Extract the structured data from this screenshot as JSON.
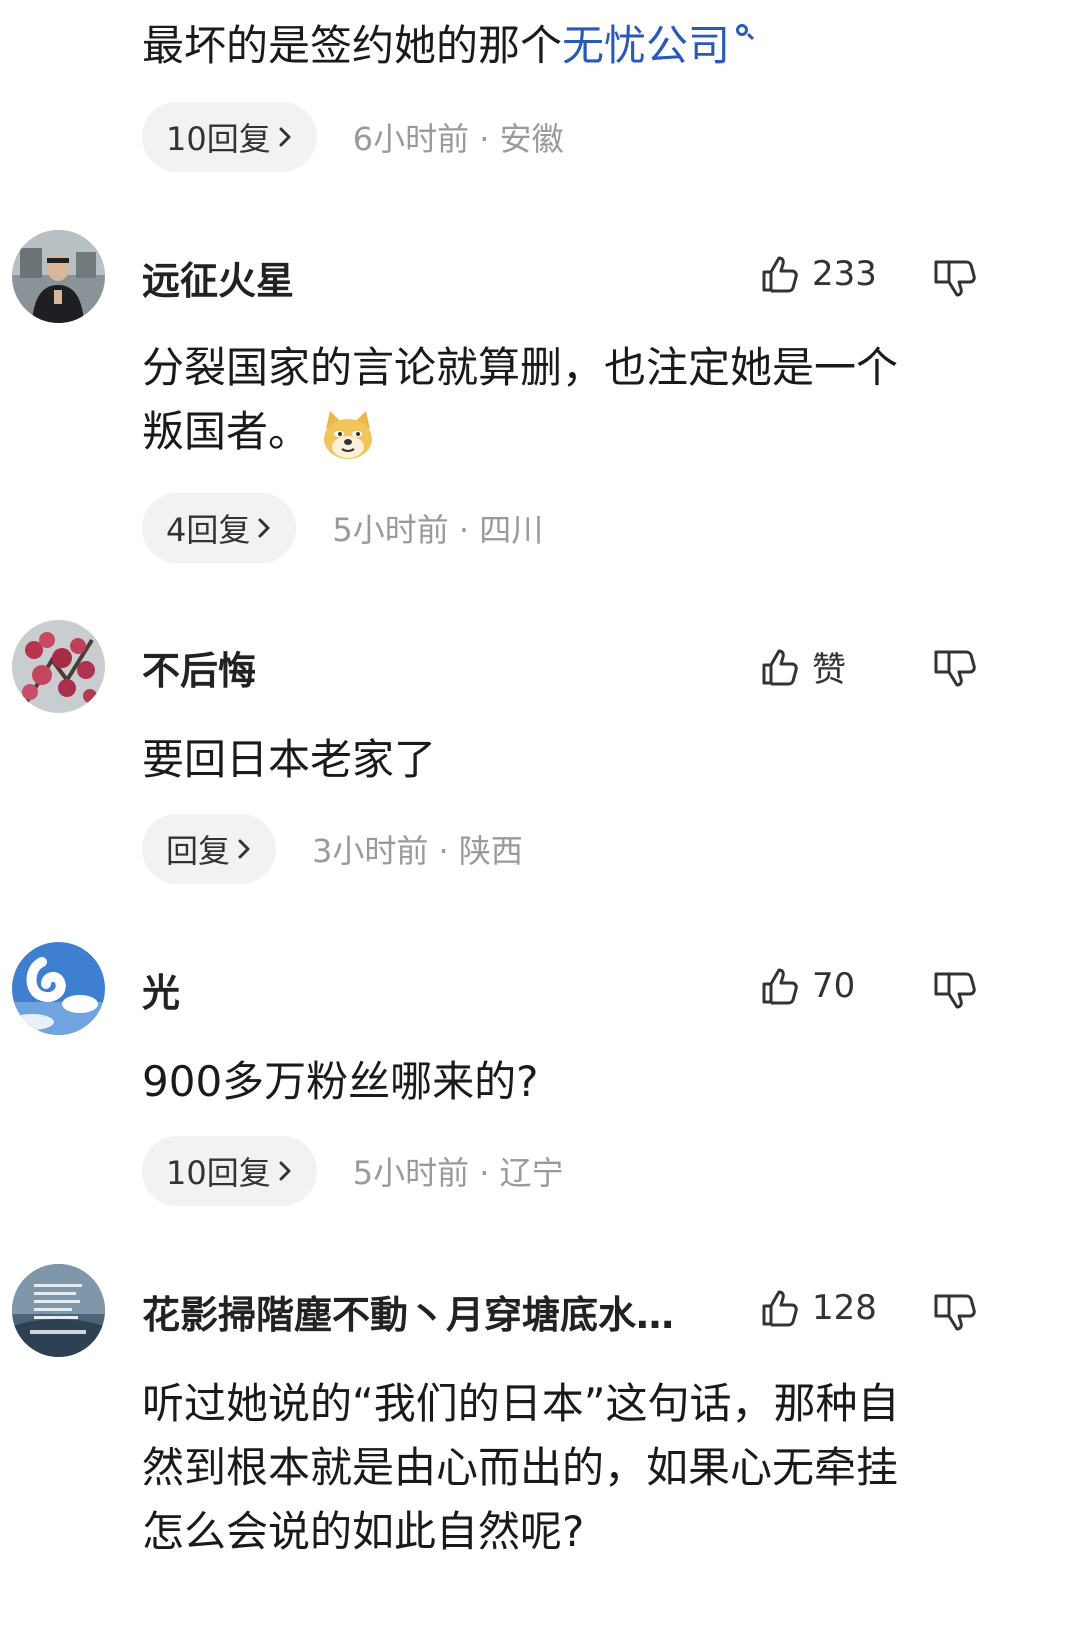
{
  "top_comment": {
    "text": "最坏的是签约她的那个",
    "link": "无忧公司",
    "reply_label": "10回复",
    "time_location": "6小时前 · 安徽"
  },
  "comments": [
    {
      "username": "远征火星",
      "likes": "233",
      "text_lines": [
        "分裂国家的言论就算删，也注定她是一个",
        "叛国者。"
      ],
      "reply_label": "4回复",
      "time_location": "5小时前 · 四川"
    },
    {
      "username": "不后悔",
      "likes": "赞",
      "text_lines": [
        "要回日本老家了"
      ],
      "reply_label": "回复",
      "time_location": "3小时前 · 陕西"
    },
    {
      "username": "光",
      "likes": "70",
      "text_lines": [
        "900多万粉丝哪来的?"
      ],
      "reply_label": "10回复",
      "time_location": "5小时前 · 辽宁"
    },
    {
      "username": "花影掃階塵不動丶月穿塘底水…",
      "likes": "128",
      "text_lines": [
        "听过她说的“我们的日本”这句话，那种自",
        "然到根本就是由心而出的，如果心无牵挂",
        "怎么会说的如此自然呢?"
      ]
    }
  ],
  "icons": {
    "like": "thumbs-up-icon",
    "dislike": "thumbs-down-icon",
    "chevron": "chevron-right-icon",
    "search": "search-icon",
    "emoji": "doge-emoji-icon"
  },
  "colors": {
    "link": "#2a5ab8",
    "meta": "#9a9a9a",
    "pill": "#f2f2f2"
  }
}
